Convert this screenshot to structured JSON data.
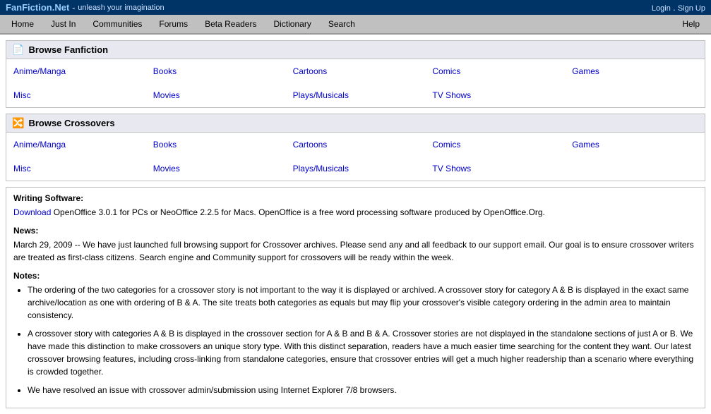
{
  "topbar": {
    "logo": "FanFiction.Net",
    "separator": " - ",
    "tagline": "unleash your imagination",
    "login": "Login",
    "separator2": " . ",
    "signup": "Sign Up"
  },
  "nav": {
    "items": [
      {
        "label": "Home",
        "name": "nav-home"
      },
      {
        "label": "Just In",
        "name": "nav-just-in"
      },
      {
        "label": "Communities",
        "name": "nav-communities"
      },
      {
        "label": "Forums",
        "name": "nav-forums"
      },
      {
        "label": "Beta Readers",
        "name": "nav-beta-readers"
      },
      {
        "label": "Dictionary",
        "name": "nav-dictionary"
      },
      {
        "label": "Search",
        "name": "nav-search"
      }
    ],
    "help": "Help"
  },
  "browse_fanfiction": {
    "title": "Browse Fanfiction",
    "icon": "📄",
    "categories_row1": [
      {
        "label": "Anime/Manga",
        "name": "cat-ff-anime"
      },
      {
        "label": "Books",
        "name": "cat-ff-books"
      },
      {
        "label": "Cartoons",
        "name": "cat-ff-cartoons"
      },
      {
        "label": "Comics",
        "name": "cat-ff-comics"
      },
      {
        "label": "Games",
        "name": "cat-ff-games"
      }
    ],
    "categories_row2": [
      {
        "label": "Misc",
        "name": "cat-ff-misc"
      },
      {
        "label": "Movies",
        "name": "cat-ff-movies"
      },
      {
        "label": "Plays/Musicals",
        "name": "cat-ff-plays"
      },
      {
        "label": "TV Shows",
        "name": "cat-ff-tvshows"
      },
      {
        "label": "",
        "name": "cat-ff-empty"
      }
    ]
  },
  "browse_crossovers": {
    "title": "Browse Crossovers",
    "icon": "🔀",
    "categories_row1": [
      {
        "label": "Anime/Manga",
        "name": "cat-co-anime"
      },
      {
        "label": "Books",
        "name": "cat-co-books"
      },
      {
        "label": "Cartoons",
        "name": "cat-co-cartoons"
      },
      {
        "label": "Comics",
        "name": "cat-co-comics"
      },
      {
        "label": "Games",
        "name": "cat-co-games"
      }
    ],
    "categories_row2": [
      {
        "label": "Misc",
        "name": "cat-co-misc"
      },
      {
        "label": "Movies",
        "name": "cat-co-movies"
      },
      {
        "label": "Plays/Musicals",
        "name": "cat-co-plays"
      },
      {
        "label": "TV Shows",
        "name": "cat-co-tvshows"
      },
      {
        "label": "",
        "name": "cat-co-empty"
      }
    ]
  },
  "writing_software": {
    "label": "Writing Software:",
    "download_text": "Download",
    "description": " OpenOffice 3.0.1 for PCs or NeoOffice 2.2.5 for Macs. OpenOffice is a free word processing software produced by OpenOffice.Org."
  },
  "news": {
    "label": "News:",
    "text": "March 29, 2009 -- We have just launched full browsing support for Crossover archives. Please send any and all feedback to our support email. Our goal is to ensure crossover writers are treated as first-class citizens. Search engine and Community support for crossovers will be ready within the week."
  },
  "notes": {
    "label": "Notes:",
    "items": [
      "The ordering of the two categories for a crossover story is not important to the way it is displayed or archived. A crossover story for category A & B is displayed in the exact same archive/location as one with ordering of B & A. The site treats both categories as equals but may flip your crossover's visible category ordering in the admin area to maintain consistency.",
      "A crossover story with categories A & B is displayed in the crossover section for A & B and B & A. Crossover stories are not displayed in the standalone sections of just A or B. We have made this distinction to make crossovers an unique story type. With this distinct separation, readers have a much easier time searching for the content they want. Our latest crossover browsing features, including cross-linking from standalone categories, ensure that crossover entries will get a much higher readership than a scenario where everything is crowded together.",
      "We have resolved an issue with crossover admin/submission using Internet Explorer 7/8 browsers."
    ]
  }
}
